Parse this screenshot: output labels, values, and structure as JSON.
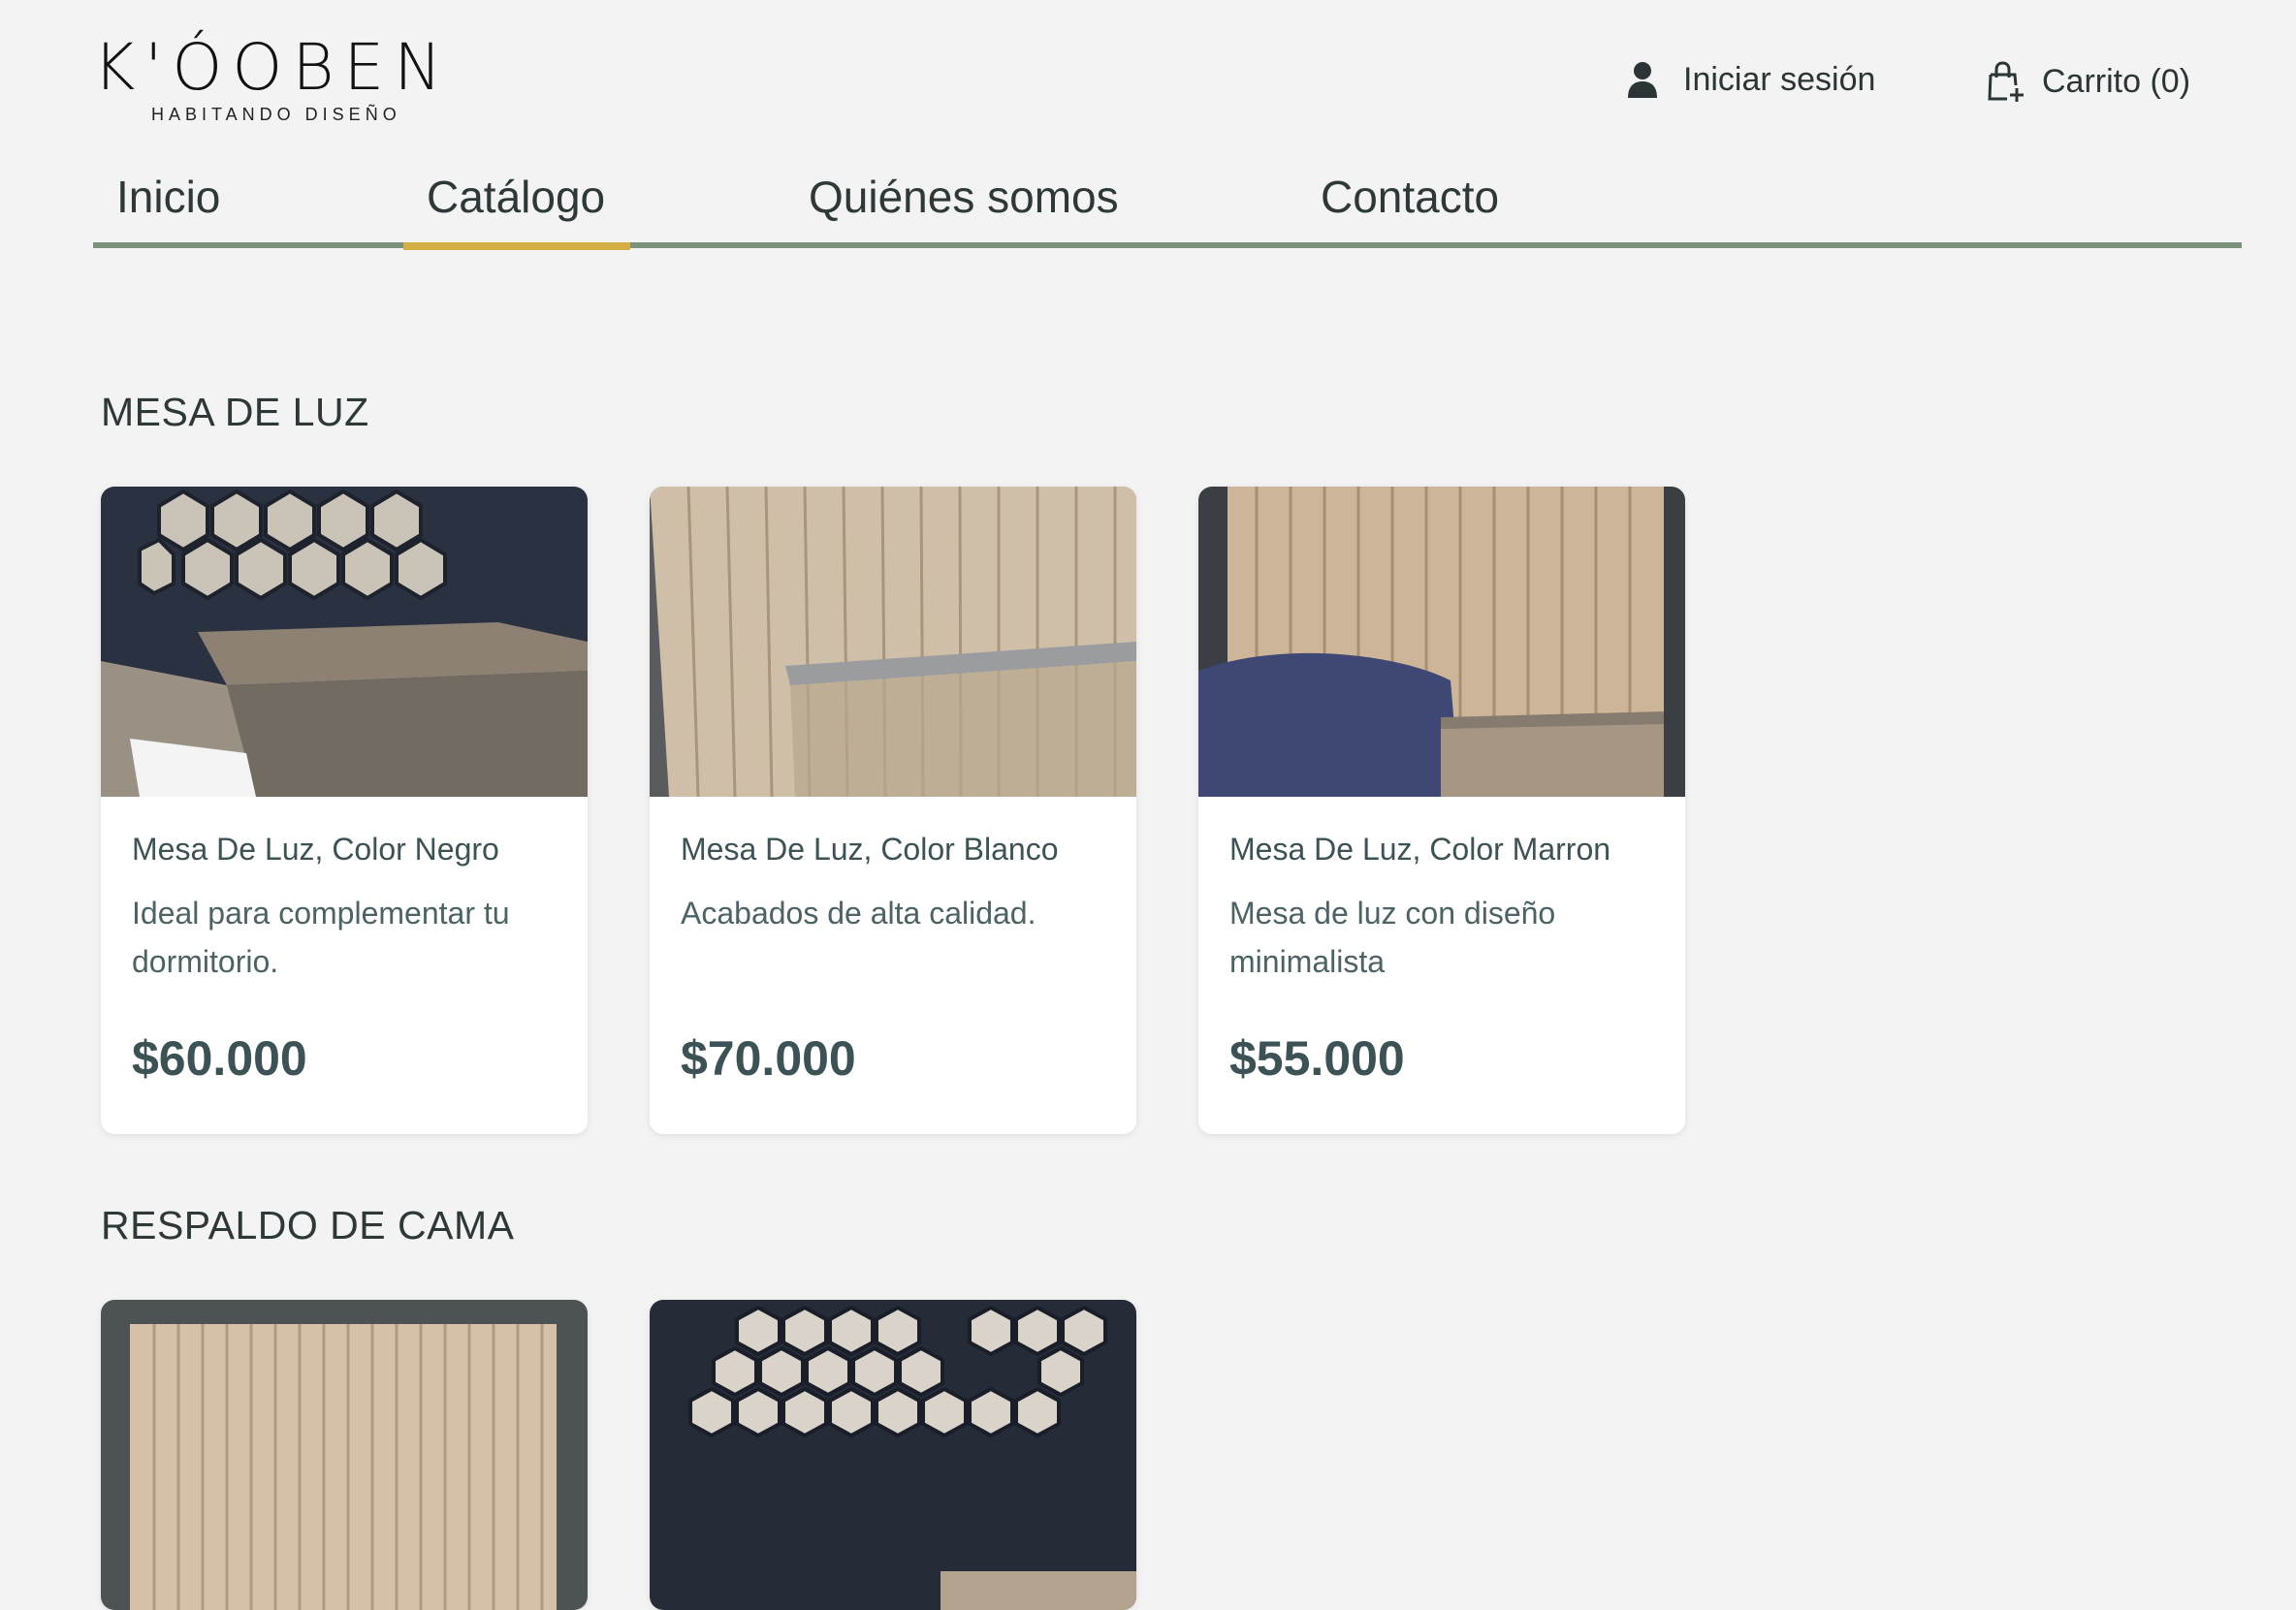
{
  "brand": {
    "name": "K'ÓOBEN",
    "tagline": "HABITANDO DISEÑO"
  },
  "header": {
    "login_label": "Iniciar sesión",
    "login_icon": "user-icon",
    "cart_label": "Carrito (0)",
    "cart_icon": "shopping-bag-plus-icon"
  },
  "nav": {
    "items": [
      {
        "label": "Inicio"
      },
      {
        "label": "Catálogo",
        "active": true
      },
      {
        "label": "Quiénes somos"
      },
      {
        "label": "Contacto"
      }
    ]
  },
  "colors": {
    "accent": "#d4ad45",
    "nav_line": "#7d927c",
    "background": "#f3f3f3"
  },
  "sections": [
    {
      "title": "MESA DE LUZ",
      "products": [
        {
          "name": "Mesa De Luz, Color Negro",
          "description": "Ideal para complementar tu dormitorio.",
          "price": "$60.000"
        },
        {
          "name": "Mesa De Luz, Color Blanco",
          "description": "Acabados de alta calidad.",
          "price": "$70.000"
        },
        {
          "name": "Mesa De Luz, Color Marron",
          "description": "Mesa de luz con diseño minimalista",
          "price": "$55.000"
        }
      ]
    },
    {
      "title": "RESPALDO DE CAMA",
      "products": [
        {
          "name": "",
          "description": "",
          "price": ""
        },
        {
          "name": "",
          "description": "",
          "price": ""
        }
      ]
    }
  ]
}
